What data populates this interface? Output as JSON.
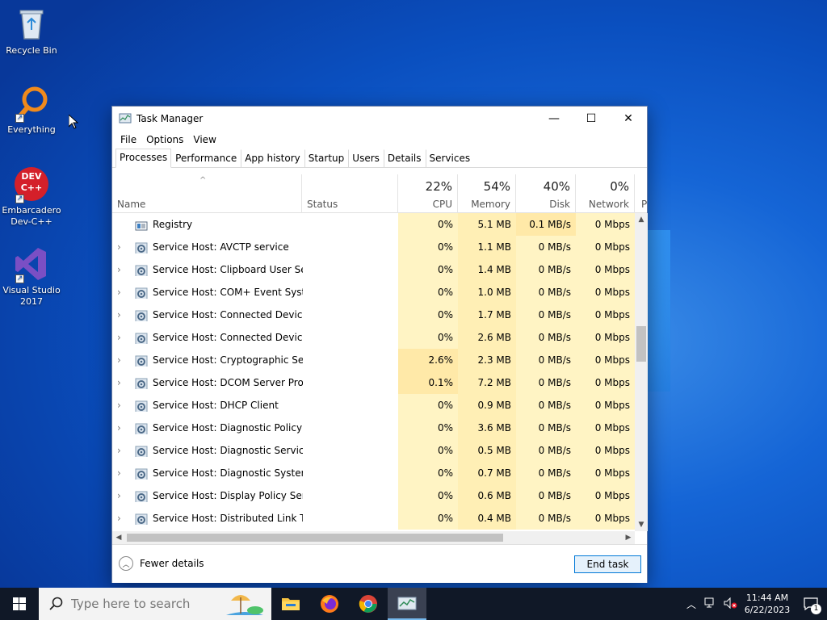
{
  "desktop": {
    "icons": [
      {
        "label": "Recycle Bin"
      },
      {
        "label": "Everything"
      },
      {
        "label": "Embarcadero Dev-C++"
      },
      {
        "label": "Visual Studio 2017"
      }
    ],
    "devcpp_icon_text": "DEV C++"
  },
  "window": {
    "title": "Task Manager",
    "minimize": "—",
    "maximize": "☐",
    "close": "✕"
  },
  "menu": [
    "File",
    "Options",
    "View"
  ],
  "tabs": [
    "Processes",
    "Performance",
    "App history",
    "Startup",
    "Users",
    "Details",
    "Services"
  ],
  "active_tab": "Processes",
  "columns": {
    "name": "Name",
    "status": "Status",
    "cpu": {
      "label": "CPU",
      "pct": "22%"
    },
    "memory": {
      "label": "Memory",
      "pct": "54%"
    },
    "disk": {
      "label": "Disk",
      "pct": "40%"
    },
    "network": {
      "label": "Network",
      "pct": "0%"
    },
    "power": {
      "label": "P"
    }
  },
  "processes": [
    {
      "name": "Registry",
      "cpu": "0%",
      "memory": "5.1 MB",
      "disk": "0.1 MB/s",
      "network": "0 Mbps",
      "expandable": false
    },
    {
      "name": "Service Host: AVCTP service",
      "cpu": "0%",
      "memory": "1.1 MB",
      "disk": "0 MB/s",
      "network": "0 Mbps",
      "expandable": true
    },
    {
      "name": "Service Host: Clipboard User Ser...",
      "cpu": "0%",
      "memory": "1.4 MB",
      "disk": "0 MB/s",
      "network": "0 Mbps",
      "expandable": true
    },
    {
      "name": "Service Host: COM+ Event Syste...",
      "cpu": "0%",
      "memory": "1.0 MB",
      "disk": "0 MB/s",
      "network": "0 Mbps",
      "expandable": true
    },
    {
      "name": "Service Host: Connected Device...",
      "cpu": "0%",
      "memory": "1.7 MB",
      "disk": "0 MB/s",
      "network": "0 Mbps",
      "expandable": true
    },
    {
      "name": "Service Host: Connected Device...",
      "cpu": "0%",
      "memory": "2.6 MB",
      "disk": "0 MB/s",
      "network": "0 Mbps",
      "expandable": true
    },
    {
      "name": "Service Host: Cryptographic Ser...",
      "cpu": "2.6%",
      "memory": "2.3 MB",
      "disk": "0 MB/s",
      "network": "0 Mbps",
      "expandable": true
    },
    {
      "name": "Service Host: DCOM Server Proc...",
      "cpu": "0.1%",
      "memory": "7.2 MB",
      "disk": "0 MB/s",
      "network": "0 Mbps",
      "expandable": true
    },
    {
      "name": "Service Host: DHCP Client",
      "cpu": "0%",
      "memory": "0.9 MB",
      "disk": "0 MB/s",
      "network": "0 Mbps",
      "expandable": true
    },
    {
      "name": "Service Host: Diagnostic Policy ...",
      "cpu": "0%",
      "memory": "3.6 MB",
      "disk": "0 MB/s",
      "network": "0 Mbps",
      "expandable": true
    },
    {
      "name": "Service Host: Diagnostic Service...",
      "cpu": "0%",
      "memory": "0.5 MB",
      "disk": "0 MB/s",
      "network": "0 Mbps",
      "expandable": true
    },
    {
      "name": "Service Host: Diagnostic System...",
      "cpu": "0%",
      "memory": "0.7 MB",
      "disk": "0 MB/s",
      "network": "0 Mbps",
      "expandable": true
    },
    {
      "name": "Service Host: Display Policy Serv...",
      "cpu": "0%",
      "memory": "0.6 MB",
      "disk": "0 MB/s",
      "network": "0 Mbps",
      "expandable": true
    },
    {
      "name": "Service Host: Distributed Link Tr...",
      "cpu": "0%",
      "memory": "0.4 MB",
      "disk": "0 MB/s",
      "network": "0 Mbps",
      "expandable": true
    }
  ],
  "footer": {
    "fewer_details": "Fewer details",
    "end_task": "End task"
  },
  "taskbar": {
    "search_placeholder": "Type here to search",
    "time": "11:44 AM",
    "date": "6/22/2023",
    "notification_count": "1",
    "apps": [
      "file-explorer-icon",
      "firefox-icon",
      "chrome-icon",
      "task-manager-icon"
    ]
  },
  "colors": {
    "accent": "#0078d7",
    "heat_low": "#fff4c4",
    "heat_high": "#ffe9a8",
    "taskbar": "#101827"
  }
}
